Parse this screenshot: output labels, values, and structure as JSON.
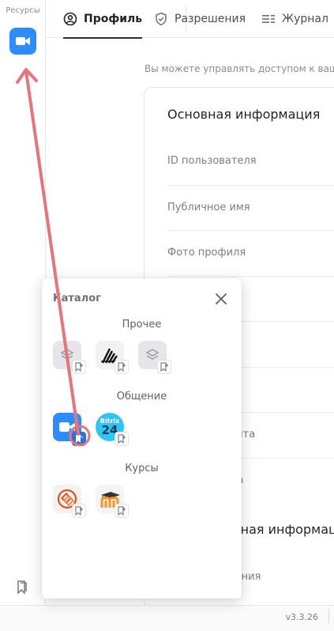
{
  "rail": {
    "title": "Ресурсы"
  },
  "tabs": [
    {
      "label": "Профиль",
      "icon": "user-circle-icon",
      "active": true
    },
    {
      "label": "Разрешения",
      "icon": "shield-check-icon",
      "active": false
    },
    {
      "label": "Журнал",
      "icon": "list-icon",
      "active": false
    }
  ],
  "profile": {
    "intro": "Вы можете управлять доступом к ваш",
    "section_title": "Основная информация",
    "section2_title": "льная информаци",
    "fields": [
      {
        "label": "ID пользователя"
      },
      {
        "label": "Публичное имя"
      },
      {
        "label": "Фото профиля"
      },
      {
        "label": "я"
      },
      {
        "label": "а"
      },
      {
        "label": "очта"
      },
      {
        "label": "на"
      },
      {
        "label": "вания"
      }
    ]
  },
  "footer": {
    "version": "v3.3.26"
  },
  "catalog": {
    "title": "Каталог",
    "categories": [
      {
        "name": "Прочее",
        "apps": [
          "layers-app-icon",
          "stairs-logo-icon",
          "layers-app-icon"
        ]
      },
      {
        "name": "Общение",
        "apps": [
          "zoom-app-icon",
          "bitrix24-app-icon"
        ]
      },
      {
        "name": "Курсы",
        "apps": [
          "courses-app-icon",
          "moodle-app-icon"
        ]
      }
    ],
    "bitrix_text_top": "Bitrix",
    "bitrix_text_num": "24"
  },
  "colors": {
    "accent": "#2d8cff",
    "annotation": "#e5757a",
    "bitrix": "#2fc6f6"
  }
}
